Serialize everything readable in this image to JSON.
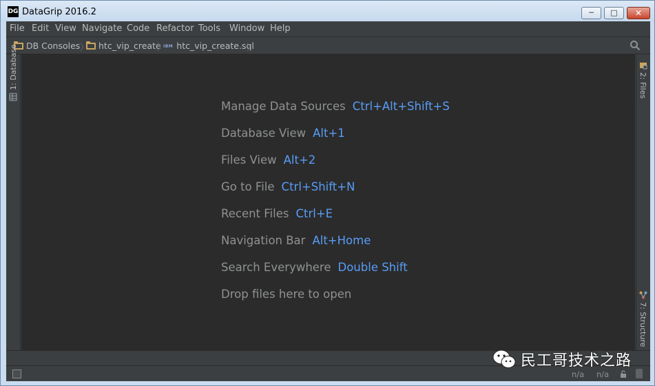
{
  "window": {
    "title": "DataGrip 2016.2",
    "app_icon_text": "DG"
  },
  "menu": [
    "File",
    "Edit",
    "View",
    "Navigate",
    "Code",
    "Refactor",
    "Tools",
    "Window",
    "Help"
  ],
  "breadcrumbs": [
    {
      "label": "DB Consoles",
      "icon": "folder-icon"
    },
    {
      "label": "htc_vip_create",
      "icon": "folder-icon"
    },
    {
      "label": "htc_vip_create.sql",
      "icon": "ibm-db2-icon",
      "icon_text": "IBM"
    }
  ],
  "left_tool_windows": [
    {
      "number": "1",
      "label": "Database",
      "text": "1: Database"
    }
  ],
  "right_tool_windows": [
    {
      "number": "2",
      "label": "Files",
      "text": "2: Files"
    },
    {
      "number": "7",
      "label": "Structure",
      "text": "7: Structure"
    }
  ],
  "welcome": {
    "items": [
      {
        "label": "Manage Data Sources",
        "shortcut": "Ctrl+Alt+Shift+S"
      },
      {
        "label": "Database View",
        "shortcut": "Alt+1"
      },
      {
        "label": "Files View",
        "shortcut": "Alt+2"
      },
      {
        "label": "Go to File",
        "shortcut": "Ctrl+Shift+N"
      },
      {
        "label": "Recent Files",
        "shortcut": "Ctrl+E"
      },
      {
        "label": "Navigation Bar",
        "shortcut": "Alt+Home"
      },
      {
        "label": "Search Everywhere",
        "shortcut": "Double Shift"
      }
    ],
    "drop_hint": "Drop files here to open"
  },
  "status": {
    "position": "n/a",
    "encoding": "n/a"
  },
  "watermark": {
    "text": "民工哥技术之路"
  },
  "colors": {
    "label": "#8f9193",
    "shortcut": "#589df6",
    "editor_bg": "#2b2b2b",
    "panel_bg": "#3c3f41"
  }
}
